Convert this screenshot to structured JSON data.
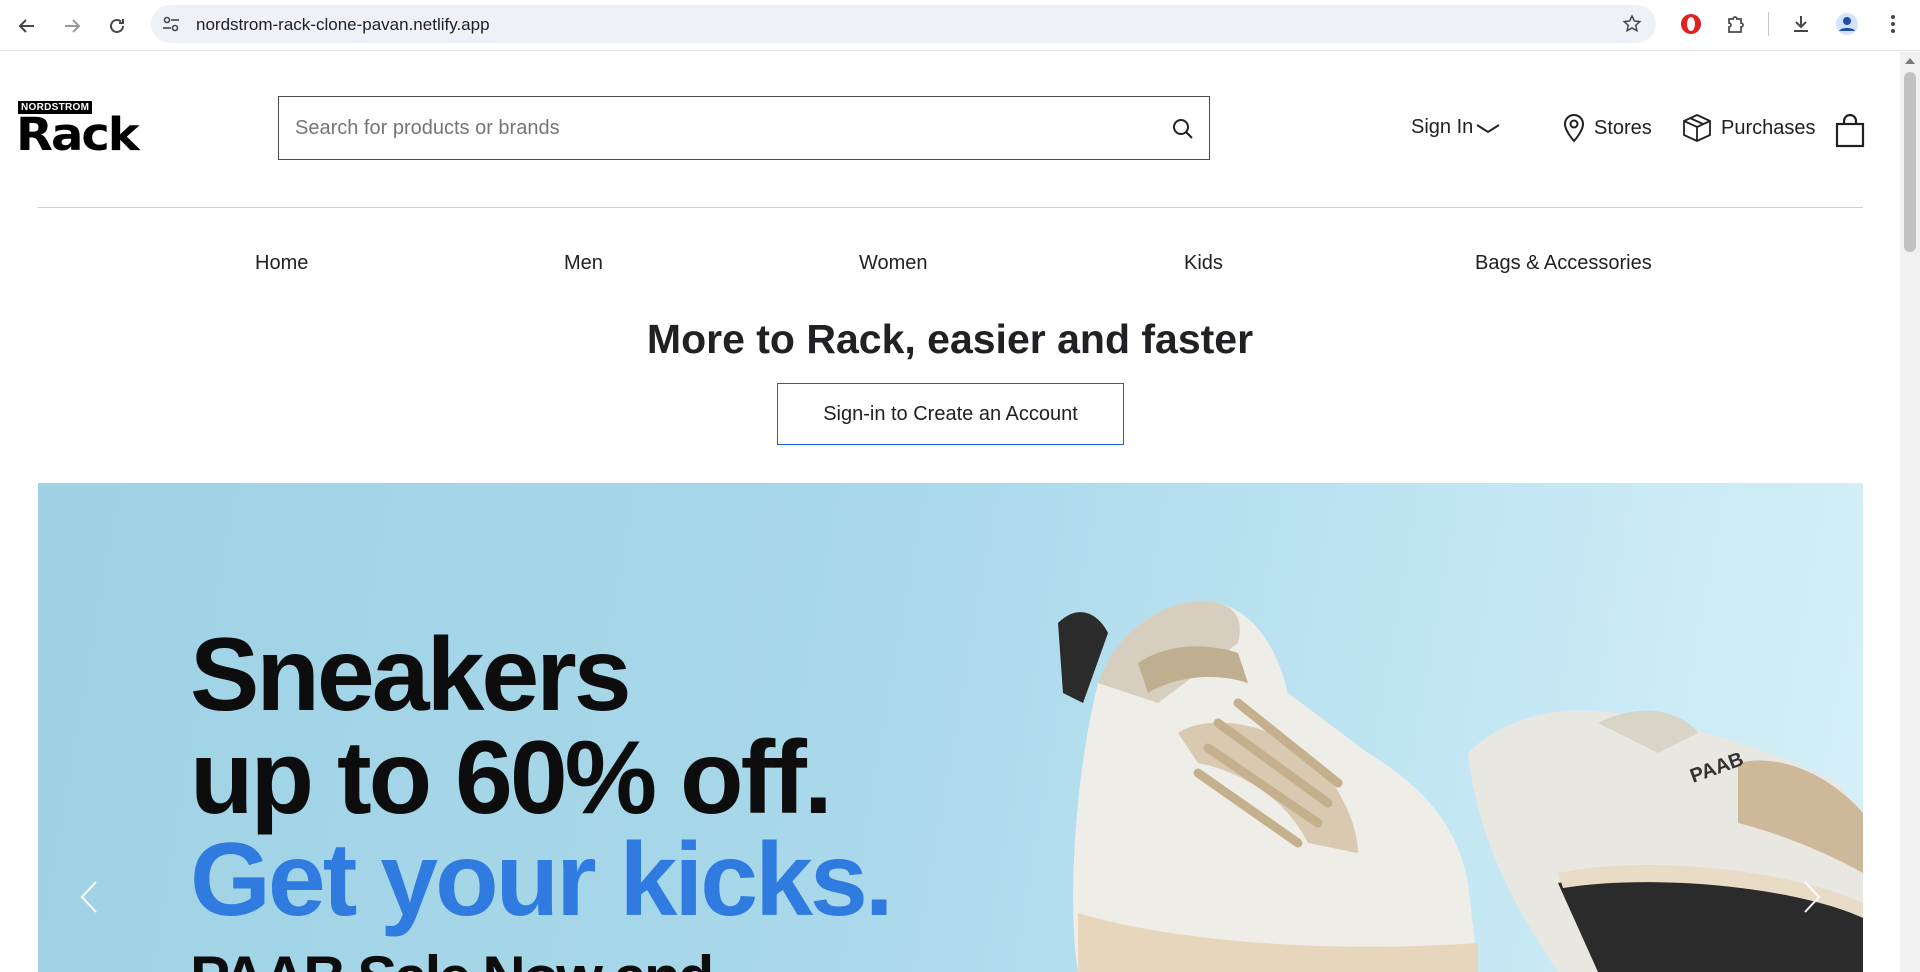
{
  "browser": {
    "url": "nordstrom-rack-clone-pavan.netlify.app"
  },
  "header": {
    "logo_top": "NORDSTROM",
    "logo_main": "Rack",
    "search_placeholder": "Search for products or brands",
    "sign_in": "Sign In",
    "stores": "Stores",
    "purchases": "Purchases"
  },
  "nav": {
    "items": [
      "Home",
      "Men",
      "Women",
      "Kids",
      "Bags & Accessories"
    ]
  },
  "promo": {
    "title": "More to Rack, easier and faster",
    "button": "Sign-in to Create an Account"
  },
  "hero": {
    "line1": "Sneakers",
    "line2": "up to 60% off.",
    "line3": "Get your kicks.",
    "line4": "PAAB Sale Now and",
    "shoe_brand": "PAAB",
    "accent_color": "#2f7be0"
  }
}
